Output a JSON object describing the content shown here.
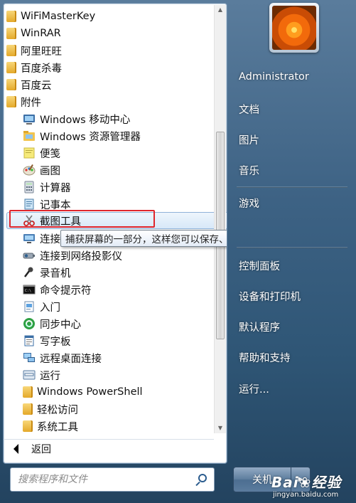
{
  "programs": {
    "items": [
      {
        "label": "WiFiMasterKey",
        "icon": "folder-icon"
      },
      {
        "label": "WinRAR",
        "icon": "folder-icon"
      },
      {
        "label": "阿里旺旺",
        "icon": "folder-icon"
      },
      {
        "label": "百度杀毒",
        "icon": "folder-icon"
      },
      {
        "label": "百度云",
        "icon": "folder-icon"
      },
      {
        "label": "附件",
        "icon": "folder-icon"
      },
      {
        "label": "Windows 移动中心",
        "icon": "mobility-center-icon"
      },
      {
        "label": "Windows 资源管理器",
        "icon": "explorer-icon"
      },
      {
        "label": "便笺",
        "icon": "sticky-notes-icon"
      },
      {
        "label": "画图",
        "icon": "paint-icon"
      },
      {
        "label": "计算器",
        "icon": "calculator-icon"
      },
      {
        "label": "记事本",
        "icon": "notepad-icon"
      },
      {
        "label": "截图工具",
        "icon": "snipping-tool-icon"
      },
      {
        "label": "连接",
        "icon": "projector-icon"
      },
      {
        "label": "连接到网络投影仪",
        "icon": "network-projector-icon"
      },
      {
        "label": "录音机",
        "icon": "microphone-icon"
      },
      {
        "label": "命令提示符",
        "icon": "cmd-icon"
      },
      {
        "label": "入门",
        "icon": "getting-started-icon"
      },
      {
        "label": "同步中心",
        "icon": "sync-center-icon"
      },
      {
        "label": "写字板",
        "icon": "wordpad-icon"
      },
      {
        "label": "远程桌面连接",
        "icon": "remote-desktop-icon"
      },
      {
        "label": "运行",
        "icon": "run-icon"
      },
      {
        "label": "Windows PowerShell",
        "icon": "folder-icon"
      },
      {
        "label": "轻松访问",
        "icon": "folder-icon"
      },
      {
        "label": "系统工具",
        "icon": "folder-icon"
      }
    ],
    "selected": "截图工具",
    "tooltip": "捕获屏幕的一部分，这样您可以保存、批注或共享图像。",
    "back_label": "返回"
  },
  "search": {
    "placeholder": "搜索程序和文件"
  },
  "right_panel": {
    "user": "Administrator",
    "items": [
      "文档",
      "图片",
      "音乐",
      "游戏",
      "控制面板",
      "设备和打印机",
      "默认程序",
      "帮助和支持",
      "运行..."
    ]
  },
  "shutdown": {
    "label": "关机"
  },
  "watermark": {
    "brand": "Bai",
    "brand_suffix": "经验",
    "url": "jingyan.baidu.com"
  },
  "colors": {
    "highlight_box": "#e0262c",
    "selection": "#d8e8f8"
  }
}
